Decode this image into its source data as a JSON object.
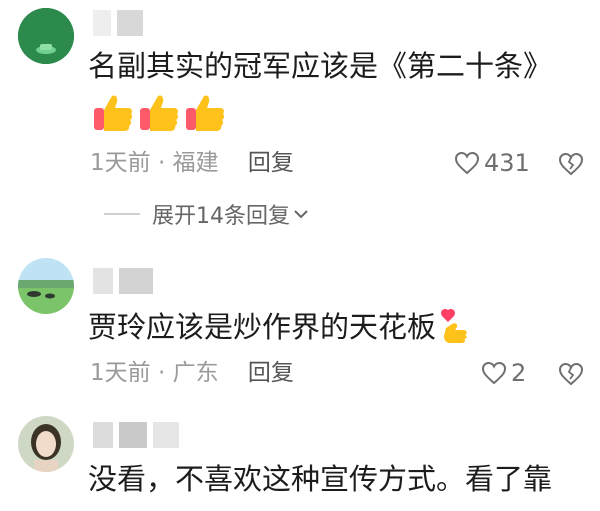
{
  "comments": [
    {
      "text": "名副其实的冠军应该是《第二十条》",
      "meta": "1天前 · 福建",
      "reply_label": "回复",
      "likes": "431",
      "expand_label": "展开14条回复"
    },
    {
      "text": "贾玲应该是炒作界的天花板",
      "meta": "1天前 · 广东",
      "reply_label": "回复",
      "likes": "2"
    },
    {
      "text": "没看，不喜欢这种宣传方式。看了靠"
    }
  ],
  "colors": {
    "meta_gray": "#9a9a9a",
    "name_mask": "#d8d8d8",
    "avatar1_green": "#2e8b4f"
  },
  "icons": [
    "thumbs-up-icon",
    "heart-outline-icon",
    "heart-broken-icon",
    "finger-heart-icon",
    "chevron-down-icon"
  ]
}
